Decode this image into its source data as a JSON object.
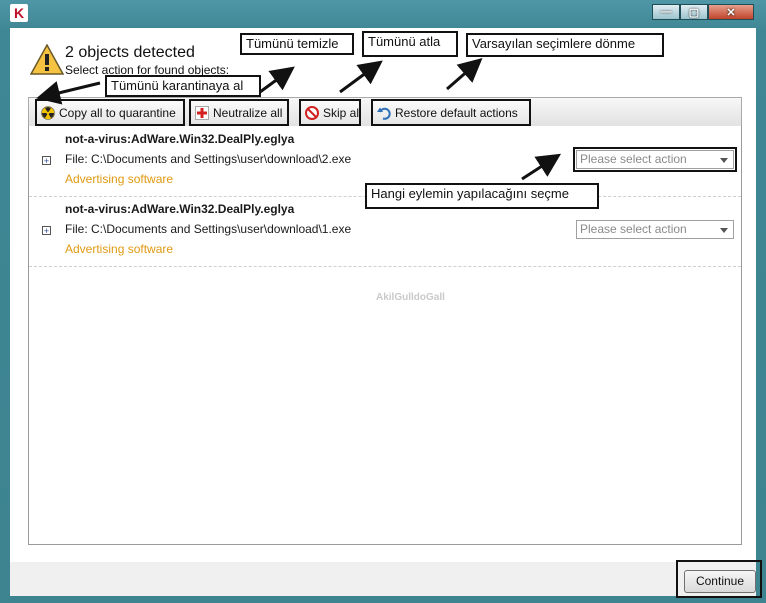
{
  "window": {
    "logo_letter": "K",
    "controls": {
      "minimize": "—",
      "maximize": "▢",
      "close": "✕"
    }
  },
  "header": {
    "title": "2 objects detected",
    "subtitle": "Select action for found objects:"
  },
  "toolbar": {
    "buttons": [
      {
        "label": "Copy all to quarantine",
        "icon": "radiation-icon"
      },
      {
        "label": "Neutralize all",
        "icon": "red-cross-icon"
      },
      {
        "label": "Skip all",
        "icon": "no-entry-icon"
      },
      {
        "label": "Restore default actions",
        "icon": "undo-arrow-icon"
      }
    ]
  },
  "items": [
    {
      "threat": "not-a-virus:AdWare.Win32.DealPly.eglya",
      "file": "File: C:\\Documents and Settings\\user\\download\\2.exe",
      "category": "Advertising software",
      "action_placeholder": "Please select action"
    },
    {
      "threat": "not-a-virus:AdWare.Win32.DealPly.eglya",
      "file": "File: C:\\Documents and Settings\\user\\download\\1.exe",
      "category": "Advertising software",
      "action_placeholder": "Please select action"
    }
  ],
  "watermark": "AkilGulldoGall",
  "footer": {
    "continue_label": "Continue"
  },
  "annotations": {
    "quarantine": "Tümünü karantinaya al",
    "neutralize": "Tümünü temizle",
    "skip": "Tümünü atla",
    "restore": "Varsayılan seçimlere dönme",
    "select_action": "Hangi eylemin yapılacağını seçme"
  },
  "colors": {
    "frame": "#3f8794",
    "category_text": "#e09a12",
    "logo_red": "#c0102a"
  }
}
